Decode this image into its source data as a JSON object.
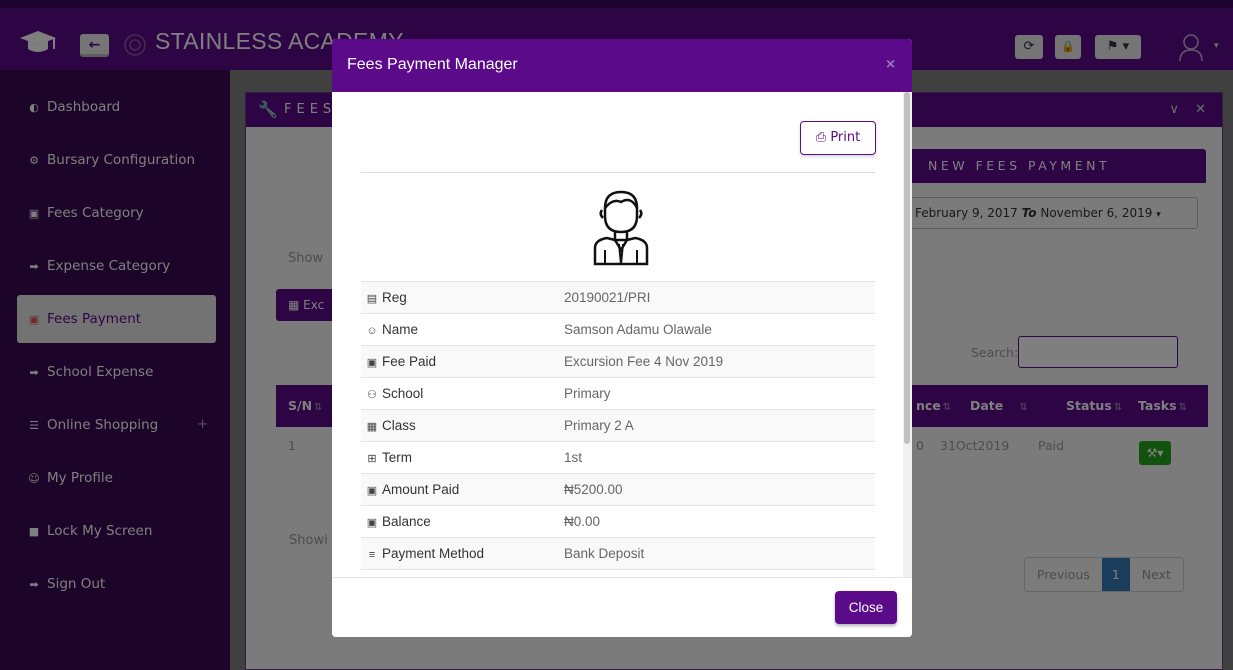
{
  "colors": {
    "brand": "#5b0b8a",
    "sidebar": "#3b0852",
    "success": "#22a61d",
    "pager_active": "#337ab7"
  },
  "header": {
    "app_title": "STAINLESS ACADEMY",
    "back_icon": "arrow-left-icon",
    "back_glyph": "←",
    "logo_icon": "graduation-cap-icon",
    "toolbar": [
      {
        "icon": "refresh-icon",
        "glyph": "⟳"
      },
      {
        "icon": "lock-icon",
        "glyph": "🔒"
      },
      {
        "icon": "flag-icon",
        "glyph": "⚑ ▾"
      }
    ],
    "user_icon": "user-avatar-icon",
    "user_caret": "▾"
  },
  "sidebar": {
    "items": [
      {
        "label": "Dashboard",
        "icon": "tachometer-icon",
        "glyph": "◐"
      },
      {
        "label": "Bursary Configuration",
        "icon": "cogs-icon",
        "glyph": "⚙"
      },
      {
        "label": "Fees Category",
        "icon": "money-icon",
        "glyph": "▣"
      },
      {
        "label": "Expense Category",
        "icon": "sign-in-icon",
        "glyph": "➡"
      },
      {
        "label": "Fees Payment",
        "icon": "money-icon",
        "glyph": "▣"
      },
      {
        "label": "School Expense",
        "icon": "sign-in-icon",
        "glyph": "➡"
      },
      {
        "label": "Online Shopping",
        "icon": "cart-icon",
        "glyph": "☰",
        "suffix": "+"
      },
      {
        "label": "My Profile",
        "icon": "user-icon",
        "glyph": "☺"
      },
      {
        "label": "Lock My Screen",
        "icon": "lock-icon",
        "glyph": "■"
      },
      {
        "label": "Sign Out",
        "icon": "sign-out-icon",
        "glyph": "➡"
      }
    ],
    "active_index": 4
  },
  "panel": {
    "title": "FEES",
    "title_icon": "wrench-icon",
    "title_glyph": "🔧",
    "controls": "∨ ✕",
    "new_tab": "NEW FEES PAYMENT",
    "date_range_from": "February 9, 2017",
    "date_range_sep": "To",
    "date_range_to": "November 6, 2019",
    "show_label": "Show",
    "excel_label": "Exc",
    "search_label": "Search:",
    "table": {
      "headers": [
        "S/N",
        "nce",
        "Date",
        "Status",
        "Tasks"
      ],
      "row": {
        "sn": "1",
        "balance": "0",
        "date": "31Oct2019",
        "status": "Paid"
      }
    },
    "showing_label": "Showi",
    "pager": {
      "prev": "Previous",
      "page": "1",
      "next": "Next"
    }
  },
  "modal": {
    "title": "Fees Payment Manager",
    "close_x": "×",
    "print_label": "Print",
    "print_glyph": "⎙",
    "avatar_icon": "student-avatar-icon",
    "rows": [
      {
        "key": "Reg",
        "value": "20190021/PRI",
        "icon": "book-icon",
        "glyph": "▤"
      },
      {
        "key": "Name",
        "value": "Samson Adamu Olawale",
        "icon": "user-icon",
        "glyph": "☺"
      },
      {
        "key": "Fee Paid",
        "value": "Excursion Fee 4 Nov 2019",
        "icon": "money-icon",
        "glyph": "▣"
      },
      {
        "key": "School",
        "value": "Primary",
        "icon": "users-icon",
        "glyph": "⚇"
      },
      {
        "key": "Class",
        "value": "Primary 2 A",
        "icon": "calendar-icon",
        "glyph": "▦"
      },
      {
        "key": "Term",
        "value": "1st",
        "icon": "calendar-plus-icon",
        "glyph": "⊞"
      },
      {
        "key": "Amount Paid",
        "value": "₦5200.00",
        "icon": "money-icon",
        "glyph": "▣"
      },
      {
        "key": "Balance",
        "value": "₦0.00",
        "icon": "money-icon",
        "glyph": "▣"
      },
      {
        "key": "Payment Method",
        "value": "Bank Deposit",
        "icon": "bars-icon",
        "glyph": "≡"
      }
    ],
    "close_label": "Close"
  }
}
